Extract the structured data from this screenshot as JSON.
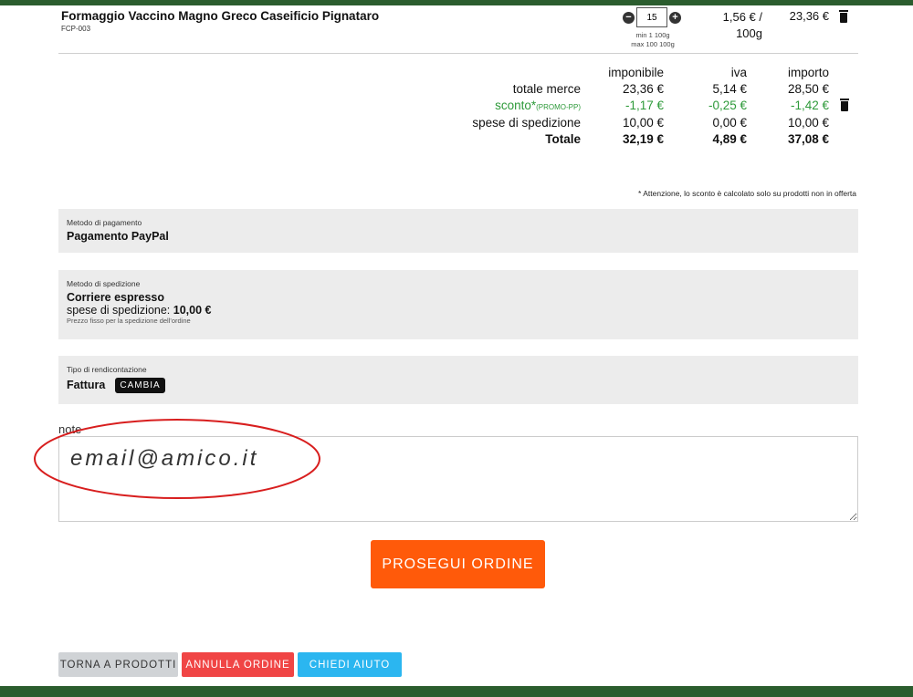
{
  "product": {
    "name": "Formaggio Vaccino Magno Greco Caseificio Pignataro",
    "code": "FCP-003",
    "quantity": "15",
    "qty_min": "min 1 100g",
    "qty_max": "max 100 100g",
    "unit_price_line1": "1,56 € /",
    "unit_price_line2": "100g",
    "line_total": "23,36 €"
  },
  "totals": {
    "headers": {
      "taxable": "imponibile",
      "vat": "iva",
      "amount": "importo"
    },
    "rows": [
      {
        "label": "totale merce",
        "taxable": "23,36 €",
        "vat": "5,14 €",
        "amount": "28,50 €"
      },
      {
        "label": "sconto*",
        "code": "(PROMO-PP)",
        "taxable": "-1,17 €",
        "vat": "-0,25 €",
        "amount": "-1,42 €"
      },
      {
        "label": "spese di spedizione",
        "taxable": "10,00 €",
        "vat": "0,00 €",
        "amount": "10,00 €"
      },
      {
        "label": "Totale",
        "taxable": "32,19 €",
        "vat": "4,89 €",
        "amount": "37,08 €"
      }
    ],
    "discount_note": "* Attenzione, lo sconto è calcolato solo su prodotti non in offerta"
  },
  "payment": {
    "caption": "Metodo di pagamento",
    "value": "Pagamento PayPal"
  },
  "shipping": {
    "caption": "Metodo di spedizione",
    "value": "Corriere espresso",
    "cost_label": "spese di spedizione:",
    "cost_value": "10,00 €",
    "note": "Prezzo fisso per la spedizione dell'ordine"
  },
  "billing": {
    "caption": "Tipo di rendicontazione",
    "value": "Fattura",
    "change_label": "CAMBIA"
  },
  "notes": {
    "label": "note",
    "value": "email@amico.it"
  },
  "actions": {
    "proceed": "PROSEGUI ORDINE",
    "back": "TORNA A PRODOTTI",
    "cancel": "ANNULLA ORDINE",
    "help": "CHIEDI AIUTO"
  },
  "colors": {
    "brand_green": "#2b5d2e",
    "discount_green": "#2e9a3a",
    "proceed_orange": "#ff5a0a",
    "cancel_red": "#f04545",
    "help_blue": "#2bb6f0",
    "annotation_red": "#d81e1e"
  }
}
